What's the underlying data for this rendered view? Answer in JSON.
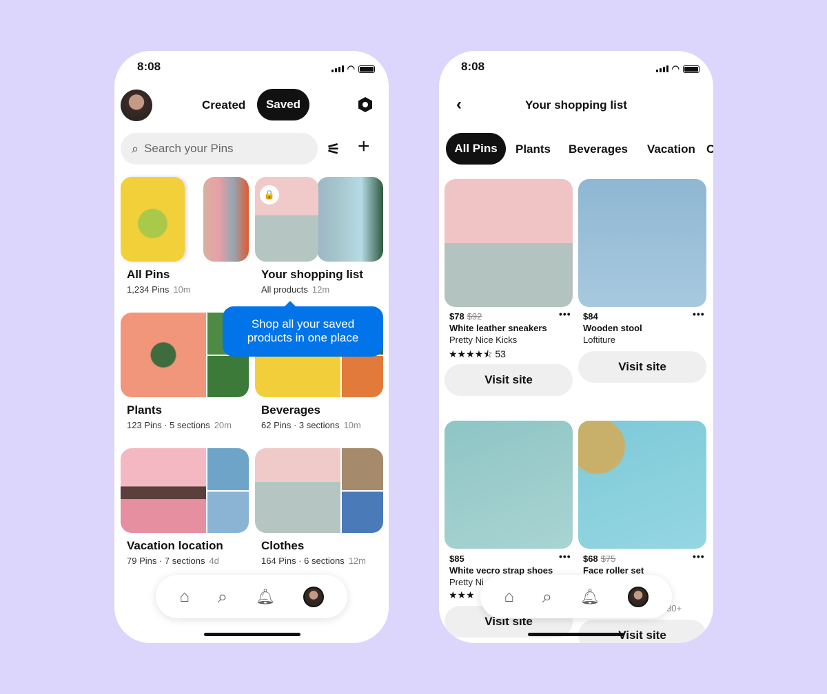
{
  "left_phone": {
    "time": "8:08",
    "tabs": {
      "created": "Created",
      "saved": "Saved"
    },
    "search": {
      "placeholder": "Search your Pins"
    },
    "boards": [
      {
        "title": "All Pins",
        "meta": "1,234 Pins",
        "time": "10m"
      },
      {
        "title": "Your shopping list",
        "meta": "All products",
        "time": "12m"
      },
      {
        "title": "Plants",
        "meta": "123 Pins · 5 sections",
        "time": "20m"
      },
      {
        "title": "Beverages",
        "meta": "62 Pins · 3 sections",
        "time": "10m"
      },
      {
        "title": "Vacation location",
        "meta": "79 Pins · 7 sections",
        "time": "4d"
      },
      {
        "title": "Clothes",
        "meta": "164 Pins · 6 sections",
        "time": "12m"
      }
    ],
    "tooltip": "Shop all your saved products in one place"
  },
  "right_phone": {
    "time": "8:08",
    "title": "Your shopping list",
    "filters": [
      "All Pins",
      "Plants",
      "Beverages",
      "Vacation",
      "C"
    ],
    "products": [
      {
        "price": "$78",
        "old_price": "$92",
        "name": "White leather sneakers",
        "brand": "Pretty Nice Kicks",
        "rating": 4.5,
        "reviews": "53",
        "cta": "Visit site"
      },
      {
        "price": "$84",
        "name": "Wooden stool",
        "brand": "Loftiture",
        "cta": "Visit site"
      },
      {
        "price": "$85",
        "name": "White vecro strap shoes",
        "brand": "Pretty Ni",
        "cta": "Visit site"
      },
      {
        "price": "$68",
        "old_price": "$75",
        "name": "Face roller set",
        "reviews": "30+",
        "cta": "Visit site"
      }
    ]
  },
  "colors": {
    "background": "#dcd6fc",
    "accent_blue": "#0074e8",
    "pill_dark": "#111111"
  }
}
